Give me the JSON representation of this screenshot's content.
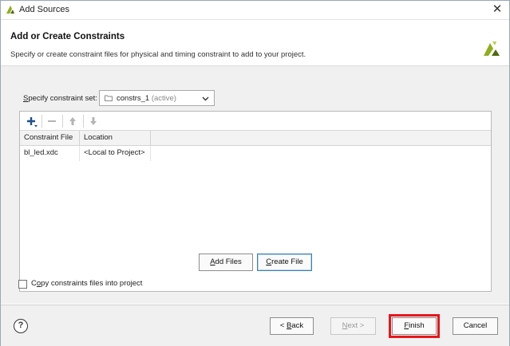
{
  "window": {
    "title": "Add Sources",
    "close_glyph": "✕"
  },
  "header": {
    "heading": "Add or Create Constraints",
    "description": "Specify or create constraint files for physical and timing constraint to add to your project.",
    "logo_icon": "vivado-logo-icon"
  },
  "constraint_set": {
    "label_mnemonic": "S",
    "label_rest": "pecify constraint set:",
    "value": "constrs_1",
    "value_suffix": "(active)"
  },
  "toolbar": {
    "add_icon": "plus-icon",
    "remove_icon": "minus-icon",
    "up_icon": "arrow-up-icon",
    "down_icon": "arrow-down-icon"
  },
  "table": {
    "columns": [
      "Constraint File",
      "Location"
    ],
    "rows": [
      {
        "file": "bl_led.xdc",
        "location": "<Local to Project>"
      }
    ]
  },
  "buttons": {
    "add_files_mn": "A",
    "add_files_rest": "dd Files",
    "create_file_mn": "C",
    "create_file_rest": "reate File",
    "back_prefix": "< ",
    "back_mn": "B",
    "back_rest": "ack",
    "next_mn": "N",
    "next_rest": "ext >",
    "finish_mn": "F",
    "finish_rest": "inish",
    "cancel": "Cancel"
  },
  "checkbox": {
    "label_mn": "o",
    "label_pre": "C",
    "label_rest": "py constraints files into project",
    "checked": false
  },
  "help": {
    "glyph": "?"
  },
  "colors": {
    "highlight": "#e8161c",
    "focus_border": "#3c7fb1",
    "accent_blue": "#1f4e8c"
  }
}
